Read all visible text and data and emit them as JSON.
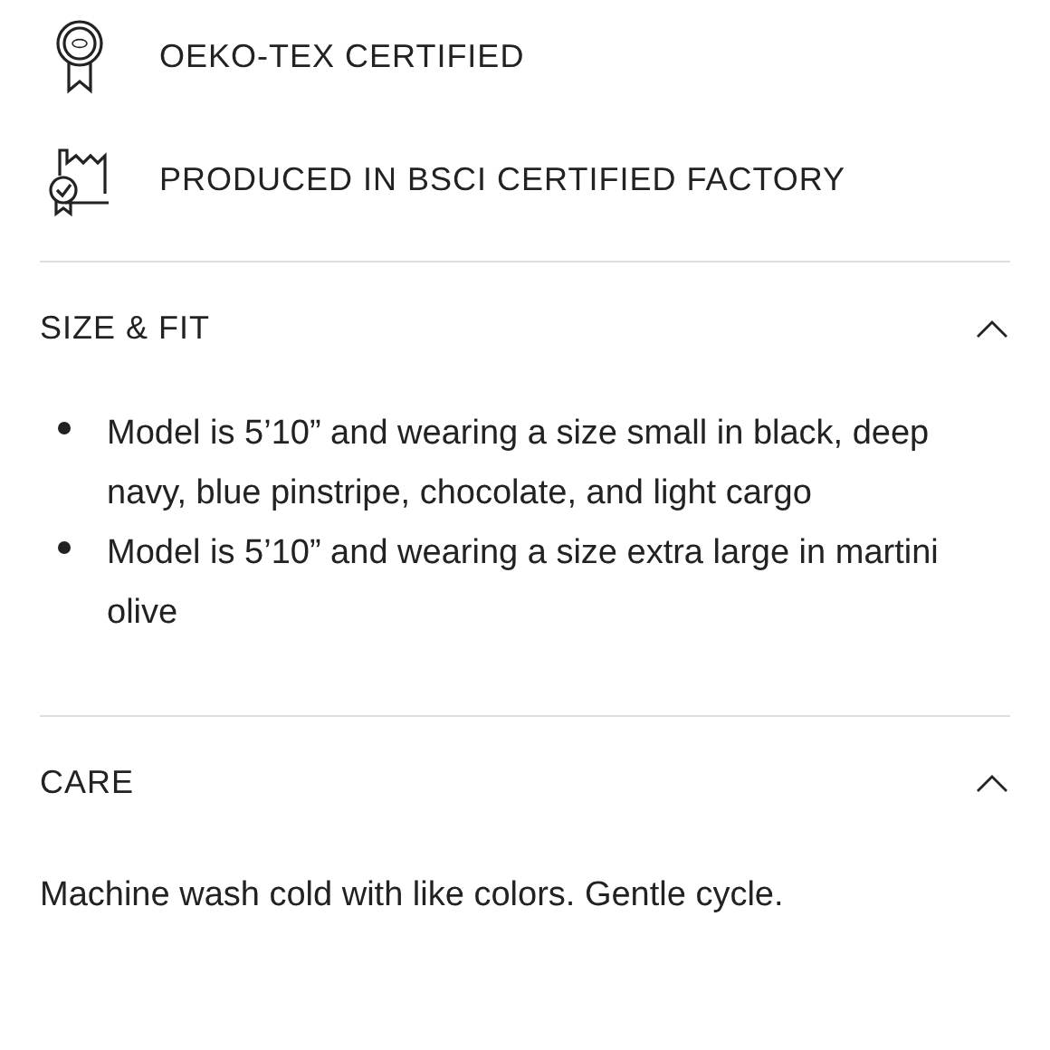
{
  "certifications": [
    {
      "kind": "oeko",
      "label": "OEKO-TEX CERTIFIED"
    },
    {
      "kind": "factory",
      "label": "PRODUCED IN BSCI CERTIFIED FACTORY"
    }
  ],
  "sections": [
    {
      "title": "SIZE & FIT",
      "expanded": true,
      "bullets": [
        "Model is 5’10” and wearing a size small in black, deep navy, blue pinstripe, chocolate, and light cargo",
        "Model is 5’10” and wearing a size extra large in martini olive"
      ]
    },
    {
      "title": "CARE",
      "expanded": true,
      "text": "Machine wash cold with like colors. Gentle cycle."
    }
  ]
}
